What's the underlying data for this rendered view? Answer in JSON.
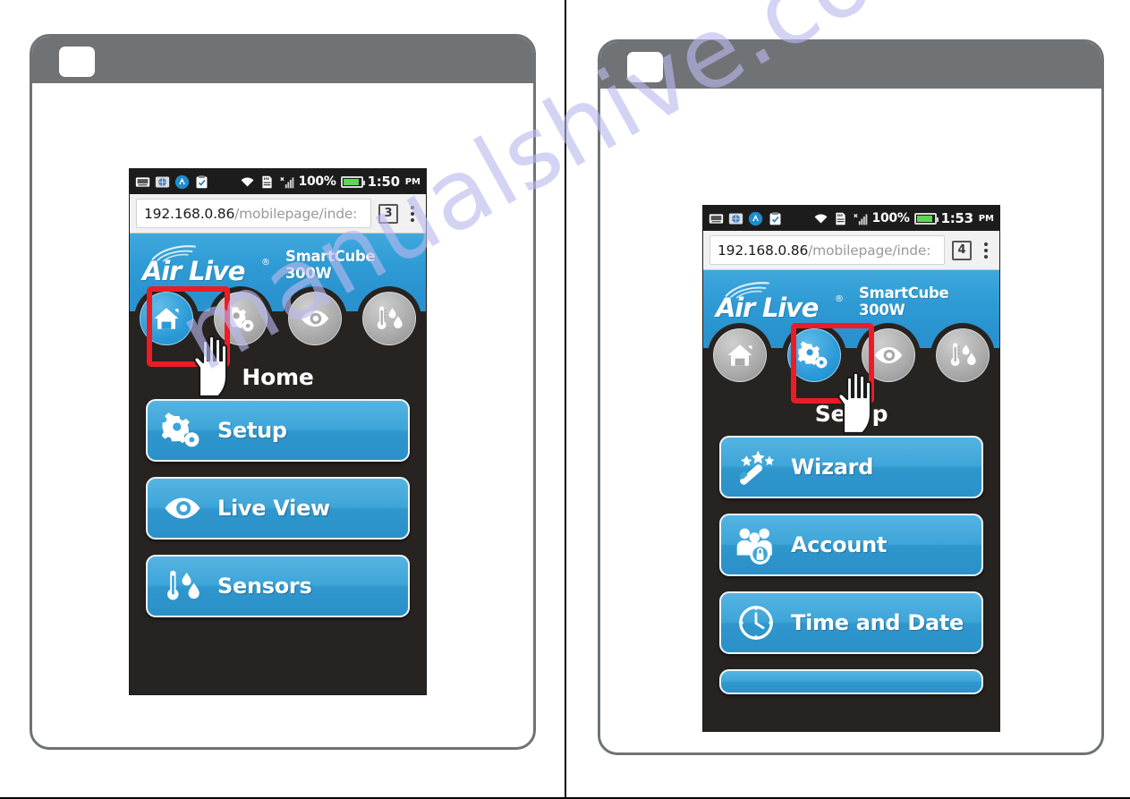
{
  "watermark": {
    "text": "manualshive.com"
  },
  "panels": [
    {
      "id": "left",
      "phone": {
        "statusbar": {
          "icons": [
            "keyboard-icon",
            "browser-sync-icon",
            "android-app-icon",
            "clipboard-icon",
            "wifi-icon",
            "sdcard-icon",
            "signal-icon"
          ],
          "battery_percent": "100%",
          "time": "1:50",
          "ampm": "PM"
        },
        "browser": {
          "url_host": "192.168.0.86",
          "url_path": "/mobilepage/inde:",
          "tab_count": "3",
          "menu_icon": "kebab-menu-icon"
        },
        "brand": {
          "name": "Air Live",
          "registered": "®",
          "model": "SmartCube 300W"
        },
        "nav": [
          {
            "icon": "home-icon",
            "name": "home",
            "active": true
          },
          {
            "icon": "gear-icon",
            "name": "setup",
            "active": false
          },
          {
            "icon": "eye-icon",
            "name": "liveview",
            "active": false
          },
          {
            "icon": "thermometer-icon",
            "name": "sensors",
            "active": false
          }
        ],
        "highlight_index": 0,
        "title": "Home",
        "menu": [
          {
            "label": "Setup",
            "icon": "gear-icon"
          },
          {
            "label": "Live View",
            "icon": "eye-icon"
          },
          {
            "label": "Sensors",
            "icon": "thermometer-icon"
          }
        ]
      }
    },
    {
      "id": "right",
      "phone": {
        "statusbar": {
          "icons": [
            "keyboard-icon",
            "browser-sync-icon",
            "android-app-icon",
            "clipboard-icon",
            "wifi-icon",
            "sdcard-icon",
            "signal-icon"
          ],
          "battery_percent": "100%",
          "time": "1:53",
          "ampm": "PM"
        },
        "browser": {
          "url_host": "192.168.0.86",
          "url_path": "/mobilepage/inde:",
          "tab_count": "4",
          "menu_icon": "kebab-menu-icon"
        },
        "brand": {
          "name": "Air Live",
          "registered": "®",
          "model": "SmartCube 300W"
        },
        "nav": [
          {
            "icon": "home-icon",
            "name": "home",
            "active": false
          },
          {
            "icon": "gear-icon",
            "name": "setup",
            "active": true
          },
          {
            "icon": "eye-icon",
            "name": "liveview",
            "active": false
          },
          {
            "icon": "thermometer-icon",
            "name": "sensors",
            "active": false
          }
        ],
        "highlight_index": 1,
        "title": "Setup",
        "menu": [
          {
            "label": "Wizard",
            "icon": "magic-wand-icon"
          },
          {
            "label": "Account",
            "icon": "users-lock-icon"
          },
          {
            "label": "Time and Date",
            "icon": "clock-icon"
          },
          {
            "label": "",
            "icon": ""
          }
        ]
      }
    }
  ],
  "colors": {
    "brand_blue": "#2e9ad4",
    "button_blue": "#3ea5d8",
    "highlight_red": "#ed1c24",
    "phone_dark": "#262321",
    "frame_gray": "#707375",
    "watermark": "#b9b9ee"
  }
}
